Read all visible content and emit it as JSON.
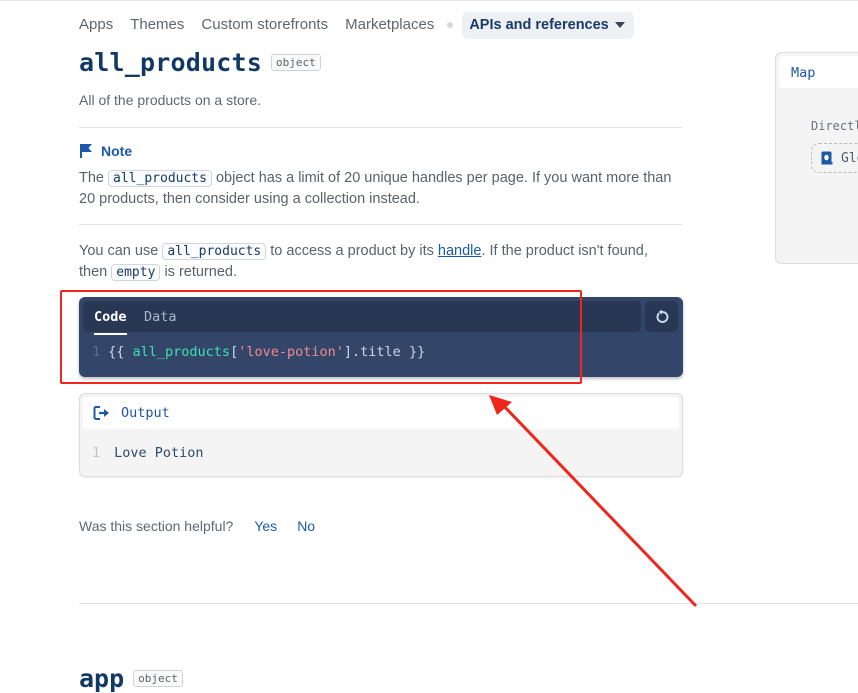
{
  "nav": {
    "items": [
      "Apps",
      "Themes",
      "Custom storefronts",
      "Marketplaces"
    ],
    "active": "APIs and references"
  },
  "object": {
    "name": "all_products",
    "type_badge": "object",
    "description": "All of the products on a store."
  },
  "note": {
    "label": "Note",
    "text_before": "The",
    "code": "all_products",
    "text_after": "object has a limit of 20 unique handles per page. If you want more than 20 products, then consider using a collection instead."
  },
  "usage": {
    "t1": "You can use",
    "code1": "all_products",
    "t2": "to access a product by its",
    "link": "handle",
    "t3": ". If the product isn't found, then",
    "code2": "empty",
    "t4": "is returned."
  },
  "code_example": {
    "tabs": [
      "Code",
      "Data"
    ],
    "active_tab": "Code",
    "line_number": "1",
    "tokens": {
      "open": "{{ ",
      "var": "all_products",
      "bracket_open": "[",
      "string": "'love-potion'",
      "bracket_close": "]",
      "prop": ".title",
      "close": " }}"
    },
    "reset_icon": "reset-icon"
  },
  "output": {
    "label": "Output",
    "line_number": "1",
    "value": "Love Potion"
  },
  "feedback": {
    "question": "Was this section helpful?",
    "yes": "Yes",
    "no": "No"
  },
  "next_object": {
    "name": "app",
    "type_badge": "object"
  },
  "map_panel": {
    "title": "Map",
    "label": "Directly",
    "chip": "Global"
  },
  "annotation": {
    "color": "#f0251c"
  }
}
